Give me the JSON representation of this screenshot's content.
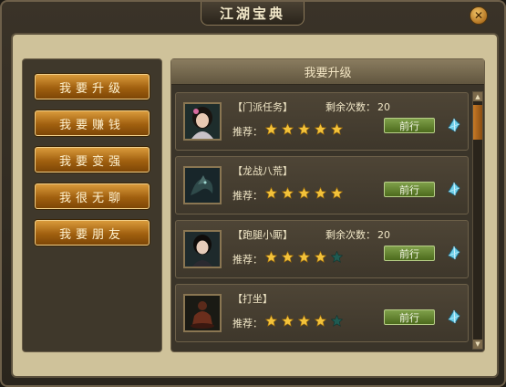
{
  "window": {
    "title": "江湖宝典",
    "close_glyph": "✕"
  },
  "menu": [
    {
      "label": "我要升级"
    },
    {
      "label": "我要赚钱"
    },
    {
      "label": "我要变强"
    },
    {
      "label": "我很无聊"
    },
    {
      "label": "我要朋友"
    }
  ],
  "panel": {
    "title": "我要升级"
  },
  "tasks": [
    {
      "name": "【门派任务】",
      "remain_label": "剩余次数：",
      "remain_value": "20",
      "rec_label": "推荐：",
      "rating": 5,
      "max_rating": 5,
      "go_label": "前行",
      "avatar": "female-portrait-icon"
    },
    {
      "name": "【龙战八荒】",
      "remain_label": "",
      "remain_value": "",
      "rec_label": "推荐：",
      "rating": 5,
      "max_rating": 5,
      "go_label": "前行",
      "avatar": "dragon-portrait-icon"
    },
    {
      "name": "【跑腿小厮】",
      "remain_label": "剩余次数：",
      "remain_value": "20",
      "rec_label": "推荐：",
      "rating": 4,
      "max_rating": 5,
      "go_label": "前行",
      "avatar": "female-portrait-icon"
    },
    {
      "name": "【打坐】",
      "remain_label": "",
      "remain_value": "",
      "rec_label": "推荐：",
      "rating": 4,
      "max_rating": 5,
      "go_label": "前行",
      "avatar": "meditation-portrait-icon"
    }
  ],
  "icons": {
    "teleport": "teleport-icon",
    "star": "star-icon"
  },
  "colors": {
    "star_on": "#f3c23a",
    "star_off": "#1f5b52",
    "button": "#a1600f",
    "go_button": "#5c7d26"
  }
}
